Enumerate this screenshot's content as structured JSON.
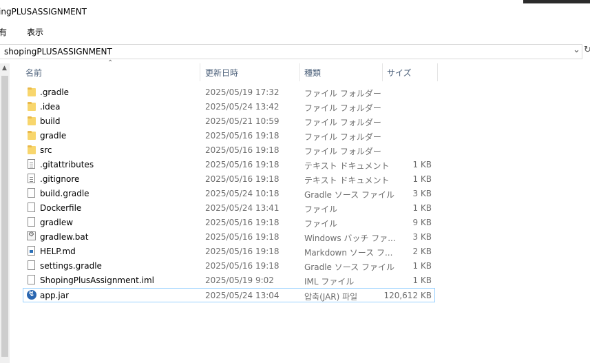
{
  "window": {
    "title": "ingPLUSASSIGNMENT"
  },
  "ribbon": {
    "items": [
      "有",
      "表示"
    ]
  },
  "address": {
    "path": "shopingPLUSASSIGNMENT"
  },
  "columns": {
    "name": "名前",
    "date": "更新日時",
    "type": "種類",
    "size": "サイズ"
  },
  "files": [
    {
      "name": ".gradle",
      "date": "2025/05/19 17:32",
      "type": "ファイル フォルダー",
      "size": "",
      "icon": "folder-icon"
    },
    {
      "name": ".idea",
      "date": "2025/05/24 13:42",
      "type": "ファイル フォルダー",
      "size": "",
      "icon": "folder-icon"
    },
    {
      "name": "build",
      "date": "2025/05/21 10:59",
      "type": "ファイル フォルダー",
      "size": "",
      "icon": "folder-icon"
    },
    {
      "name": "gradle",
      "date": "2025/05/16 19:18",
      "type": "ファイル フォルダー",
      "size": "",
      "icon": "folder-icon"
    },
    {
      "name": "src",
      "date": "2025/05/16 19:18",
      "type": "ファイル フォルダー",
      "size": "",
      "icon": "folder-icon"
    },
    {
      "name": ".gitattributes",
      "date": "2025/05/16 19:18",
      "type": "テキスト ドキュメント",
      "size": "1 KB",
      "icon": "text-document-icon"
    },
    {
      "name": ".gitignore",
      "date": "2025/05/16 19:18",
      "type": "テキスト ドキュメント",
      "size": "1 KB",
      "icon": "text-document-icon"
    },
    {
      "name": "build.gradle",
      "date": "2025/05/24 10:18",
      "type": "Gradle ソース ファイル",
      "size": "3 KB",
      "icon": "file-icon"
    },
    {
      "name": "Dockerfile",
      "date": "2025/05/24 13:41",
      "type": "ファイル",
      "size": "1 KB",
      "icon": "file-icon"
    },
    {
      "name": "gradlew",
      "date": "2025/05/16 19:18",
      "type": "ファイル",
      "size": "9 KB",
      "icon": "file-icon"
    },
    {
      "name": "gradlew.bat",
      "date": "2025/05/16 19:18",
      "type": "Windows バッチ ファ...",
      "size": "3 KB",
      "icon": "batch-file-icon"
    },
    {
      "name": "HELP.md",
      "date": "2025/05/16 19:18",
      "type": "Markdown ソース フ...",
      "size": "2 KB",
      "icon": "markdown-file-icon"
    },
    {
      "name": "settings.gradle",
      "date": "2025/05/16 19:18",
      "type": "Gradle ソース ファイル",
      "size": "1 KB",
      "icon": "file-icon"
    },
    {
      "name": "ShopingPlusAssignment.iml",
      "date": "2025/05/19 9:02",
      "type": "IML ファイル",
      "size": "1 KB",
      "icon": "file-icon"
    },
    {
      "name": "app.jar",
      "date": "2025/05/24 13:04",
      "type": "압축(JAR) 파일",
      "size": "120,612 KB",
      "icon": "jar-file-icon",
      "selected": true
    }
  ],
  "colors": {
    "selection_border": "#99d1ff",
    "folder": "#f8d66d",
    "header_text": "#4c607a"
  }
}
